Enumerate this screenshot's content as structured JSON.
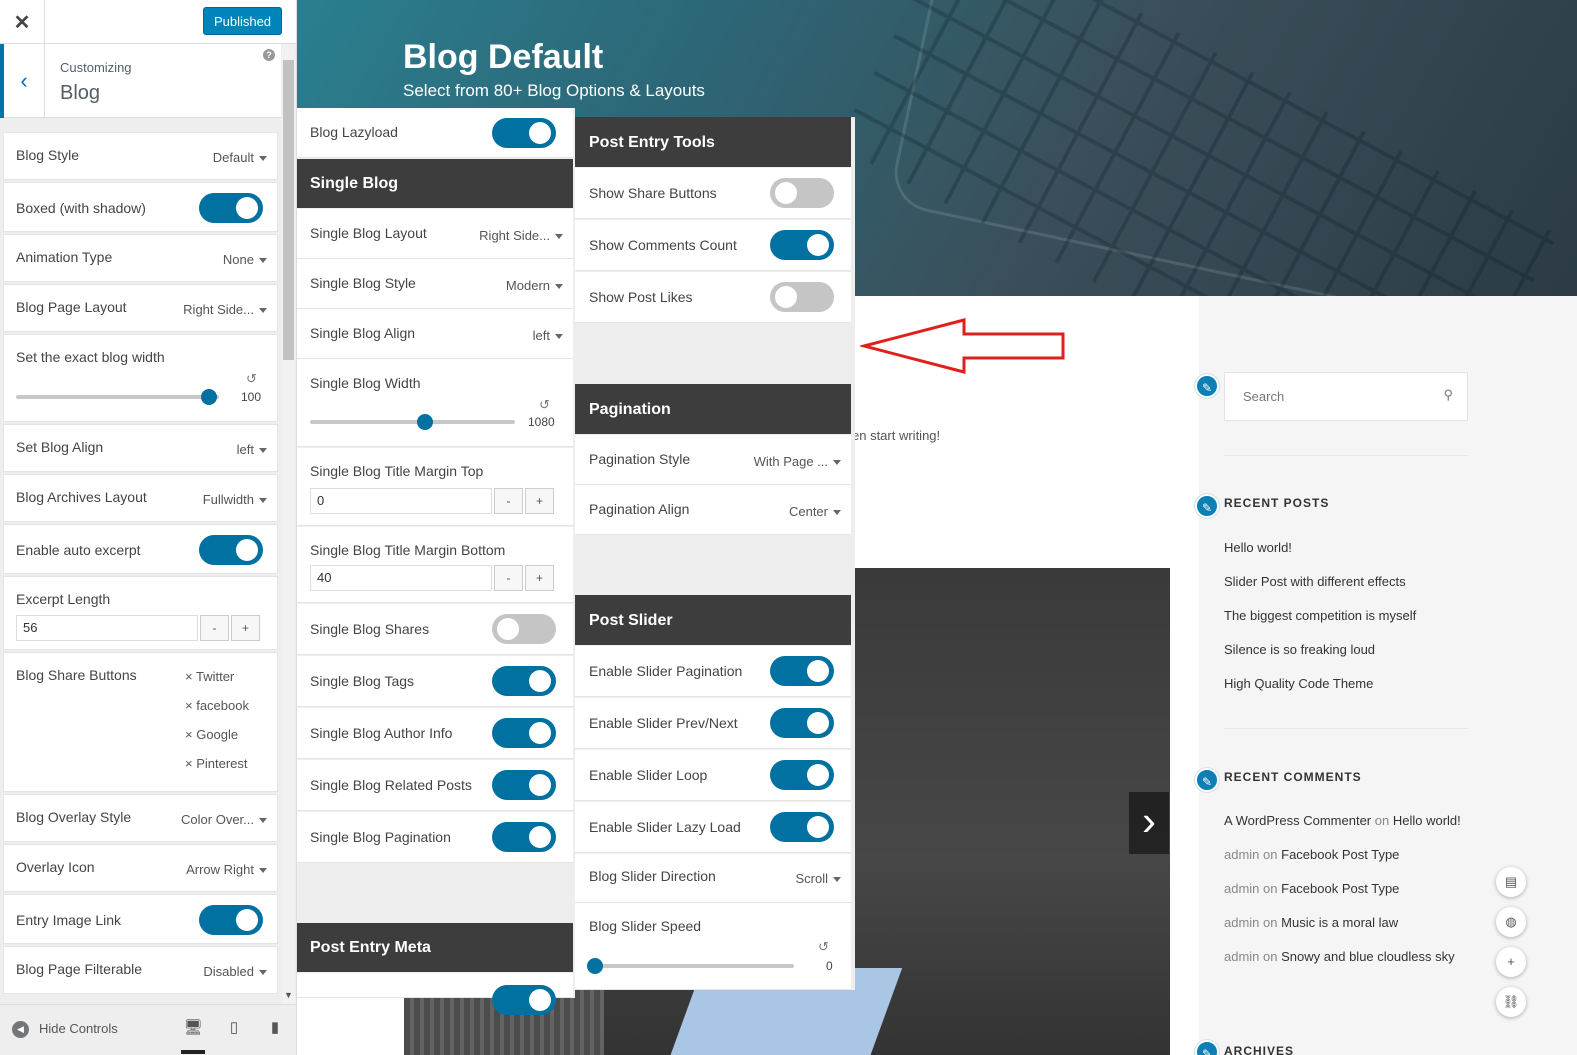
{
  "header": {
    "published_label": "Published",
    "customizing_label": "Customizing",
    "section_title": "Blog"
  },
  "sidebar": {
    "blog_style": {
      "label": "Blog Style",
      "value": "Default"
    },
    "boxed": {
      "label": "Boxed (with shadow)",
      "on": true
    },
    "animation_type": {
      "label": "Animation Type",
      "value": "None"
    },
    "blog_page_layout": {
      "label": "Blog Page Layout",
      "value": "Right Side..."
    },
    "blog_width": {
      "label": "Set the exact blog width",
      "value": "100",
      "fraction": 0.95
    },
    "blog_align": {
      "label": "Set Blog Align",
      "value": "left"
    },
    "archives_layout": {
      "label": "Blog Archives Layout",
      "value": "Fullwidth"
    },
    "auto_excerpt": {
      "label": "Enable auto excerpt",
      "on": true
    },
    "excerpt_length": {
      "label": "Excerpt Length",
      "value": "56"
    },
    "share_buttons": {
      "label": "Blog Share Buttons",
      "items": [
        "Twitter",
        "facebook",
        "Google",
        "Pinterest"
      ]
    },
    "overlay_style": {
      "label": "Blog Overlay Style",
      "value": "Color Over..."
    },
    "overlay_icon": {
      "label": "Overlay Icon",
      "value": "Arrow Right"
    },
    "entry_image_link": {
      "label": "Entry Image Link",
      "on": true
    },
    "page_filterable": {
      "label": "Blog Page Filterable",
      "value": "Disabled"
    }
  },
  "footer": {
    "hide_controls": "Hide Controls"
  },
  "hero": {
    "title": "Blog Default",
    "subtitle": "Select from 80+ Blog Options & Layouts"
  },
  "panel1": {
    "lazyload": {
      "label": "Blog Lazyload",
      "on": true
    },
    "single_blog_heading": "Single Blog",
    "single_layout": {
      "label": "Single Blog Layout",
      "value": "Right Side..."
    },
    "single_style": {
      "label": "Single Blog Style",
      "value": "Modern"
    },
    "single_align": {
      "label": "Single Blog Align",
      "value": "left"
    },
    "single_width": {
      "label": "Single Blog Width",
      "value": "1080",
      "fraction": 0.56
    },
    "title_margin_top": {
      "label": "Single Blog Title Margin Top",
      "value": "0"
    },
    "title_margin_bottom": {
      "label": "Single Blog Title Margin Bottom",
      "value": "40"
    },
    "shares": {
      "label": "Single Blog Shares",
      "on": false
    },
    "tags": {
      "label": "Single Blog Tags",
      "on": true
    },
    "author_info": {
      "label": "Single Blog Author Info",
      "on": true
    },
    "related_posts": {
      "label": "Single Blog Related Posts",
      "on": true
    },
    "pagination": {
      "label": "Single Blog Pagination",
      "on": true
    },
    "post_entry_meta_heading": "Post Entry Meta"
  },
  "panel2": {
    "tools_heading": "Post Entry Tools",
    "share_buttons": {
      "label": "Show Share Buttons",
      "on": false
    },
    "comments_count": {
      "label": "Show Comments Count",
      "on": true
    },
    "post_likes": {
      "label": "Show Post Likes",
      "on": false
    },
    "pagination_heading": "Pagination",
    "pagination_style": {
      "label": "Pagination Style",
      "value": "With Page ..."
    },
    "pagination_align": {
      "label": "Pagination Align",
      "value": "Center"
    },
    "slider_heading": "Post Slider",
    "slider_pagination": {
      "label": "Enable Slider Pagination",
      "on": true
    },
    "slider_prevnext": {
      "label": "Enable Slider Prev/Next",
      "on": true
    },
    "slider_loop": {
      "label": "Enable Slider Loop",
      "on": true
    },
    "slider_lazy": {
      "label": "Enable Slider Lazy Load",
      "on": true
    },
    "slider_direction": {
      "label": "Blog Slider Direction",
      "value": "Scroll"
    },
    "slider_speed": {
      "label": "Blog Slider Speed",
      "value": "0",
      "fraction": 0.0
    }
  },
  "preview": {
    "search_placeholder": "Search",
    "start_writing": "en start writing!",
    "recent_posts_title": "RECENT POSTS",
    "recent_posts": [
      "Hello world!",
      "Slider Post with different effects",
      "The biggest competition is myself",
      "Silence is so freaking loud",
      "High Quality Code Theme"
    ],
    "recent_comments_title": "RECENT COMMENTS",
    "recent_comments": [
      {
        "author": "A WordPress Commenter",
        "on": "on",
        "post": "Hello world!"
      },
      {
        "author": "admin",
        "on": "on",
        "post": "Facebook Post Type"
      },
      {
        "author": "admin",
        "on": "on",
        "post": "Facebook Post Type"
      },
      {
        "author": "admin",
        "on": "on",
        "post": "Music is a moral law"
      },
      {
        "author": "admin",
        "on": "on",
        "post": "Snowy and blue cloudless sky"
      }
    ],
    "archives_title": "ARCHIVES"
  },
  "colors": {
    "accent": "#0071a1",
    "panel_header": "#3d3d3d",
    "arrow": "#e0201b"
  }
}
